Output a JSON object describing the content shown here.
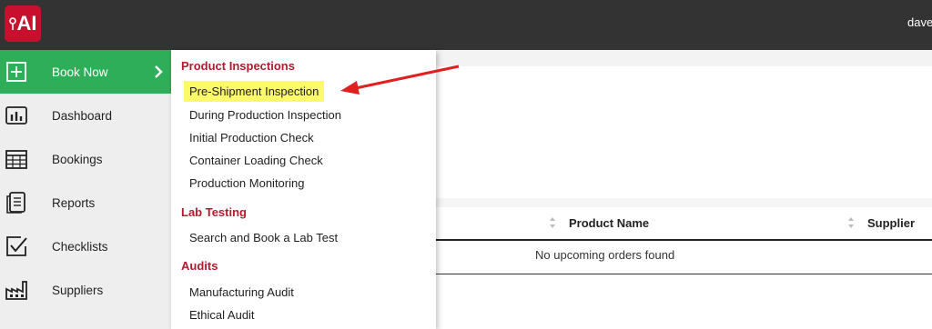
{
  "app": {
    "logo_text": "AI"
  },
  "header": {
    "user": "dave"
  },
  "sidebar": {
    "items": [
      {
        "label": "Book Now",
        "icon": "plus-square-icon",
        "active": true
      },
      {
        "label": "Dashboard",
        "icon": "bar-chart-icon"
      },
      {
        "label": "Bookings",
        "icon": "calendar-icon"
      },
      {
        "label": "Reports",
        "icon": "report-icon"
      },
      {
        "label": "Checklists",
        "icon": "checkbox-icon"
      },
      {
        "label": "Suppliers",
        "icon": "factory-icon"
      }
    ]
  },
  "dropdown": {
    "groups": [
      {
        "heading": "Product Inspections",
        "items": [
          "Pre-Shipment Inspection",
          "During Production Inspection",
          "Initial Production Check",
          "Container Loading Check",
          "Production Monitoring"
        ]
      },
      {
        "heading": "Lab Testing",
        "items": [
          "Search and Book a Lab Test"
        ]
      },
      {
        "heading": "Audits",
        "items": [
          "Manufacturing Audit",
          "Ethical Audit"
        ]
      }
    ],
    "highlighted_item": "Pre-Shipment Inspection"
  },
  "table": {
    "columns": [
      "Product Name",
      "Supplier"
    ],
    "empty_message": "No upcoming orders found"
  },
  "colors": {
    "topbar": "#333333",
    "logo": "#c8102e",
    "active_green": "#2fae5a",
    "heading_red": "#b01c2e",
    "highlight_yellow": "#fcf96b",
    "arrow_red": "#e02020"
  }
}
